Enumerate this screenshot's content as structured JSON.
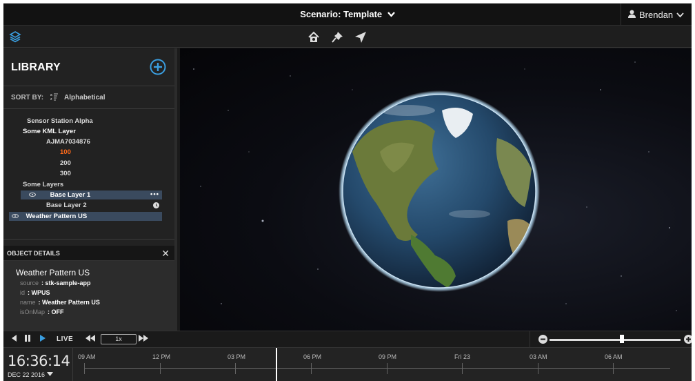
{
  "header": {
    "scenario_label": "Scenario: Template",
    "user_name": "Brendan"
  },
  "toolbar": {
    "icons": [
      "layers-icon",
      "home-icon",
      "pin-icon",
      "locate-arrow-icon"
    ]
  },
  "library": {
    "title": "LIBRARY",
    "sort_label": "SORT BY:",
    "sort_value": "Alphabetical",
    "tree": [
      {
        "label": "Sensor Station Alpha"
      },
      {
        "label": "Some KML Layer"
      },
      {
        "label": "AJMA7034876"
      },
      {
        "label": "100",
        "highlighted": true
      },
      {
        "label": "200"
      },
      {
        "label": "300"
      },
      {
        "label": "Some Layers"
      },
      {
        "label": "Base Layer 1",
        "selected": true,
        "visible": true
      },
      {
        "label": "Base Layer 2"
      },
      {
        "label": "Weather Pattern US",
        "selected": true,
        "visible": true
      }
    ]
  },
  "object_details": {
    "header": "OBJECT DETAILS",
    "title": "Weather Pattern US",
    "props": [
      {
        "key": "source",
        "value": ": stk-sample-app"
      },
      {
        "key": "id",
        "value": ": WPUS"
      },
      {
        "key": "name",
        "value": ": Weather Pattern US"
      },
      {
        "key": "isOnMap",
        "value": ": OFF"
      }
    ]
  },
  "playback": {
    "live_label": "LIVE",
    "speed": "1x",
    "zoom_level": 0.55
  },
  "timeline": {
    "time": "16:36:14",
    "date": "DEC 22 2016",
    "labels": [
      "09 AM",
      "12 PM",
      "03 PM",
      "06 PM",
      "09 PM",
      "Fri 23",
      "03 AM",
      "06 AM"
    ]
  },
  "colors": {
    "accent_blue": "#3a9ee0",
    "highlight_orange": "#ff6a1a",
    "selected_row": "#3a4a5e"
  }
}
